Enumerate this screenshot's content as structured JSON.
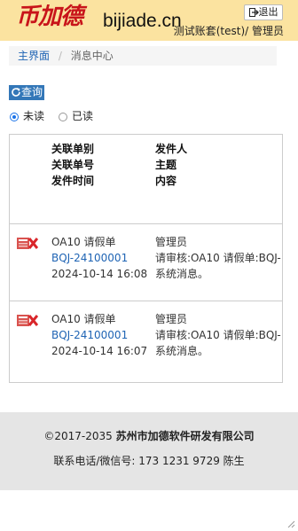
{
  "header": {
    "logo_cn": "币加德",
    "logo_en": "bijiade.cn",
    "logout_label": "退出",
    "user_info": "测试账套(test)/ 管理员"
  },
  "breadcrumb": {
    "home": "主界面",
    "separator": "/",
    "current": "消息中心"
  },
  "toolbar": {
    "query_label": "查询"
  },
  "filter": {
    "unread_label": "未读",
    "read_label": "已读",
    "selected": "未读"
  },
  "table": {
    "headers": {
      "col1": [
        "关联单别",
        "关联单号",
        "发件时间"
      ],
      "col2": [
        "发件人",
        "主题",
        "内容"
      ]
    },
    "rows": [
      {
        "doc_type": "OA10 请假单",
        "doc_no": "BQJ-24100001",
        "time": "2024-10-14 16:08",
        "sender": "管理员",
        "subject": "请审核:OA10 请假单:BQJ-",
        "content": "系统消息。"
      },
      {
        "doc_type": "OA10 请假单",
        "doc_no": "BQJ-24100001",
        "time": "2024-10-14 16:07",
        "sender": "管理员",
        "subject": "请审核:OA10 请假单:BQJ-",
        "content": "系统消息。"
      }
    ]
  },
  "footer": {
    "copyright": "©2017-2035",
    "company": "苏州市加德软件研发有限公司",
    "contact": "联系电话/微信号: 173 1231 9729 陈生"
  },
  "colors": {
    "header_bg": "#fbe3a0",
    "logo_red": "#c8141a",
    "link_blue": "#1f64b4",
    "button_blue": "#3377b8",
    "footer_bg": "#e5e5e5"
  },
  "icons": [
    "logout-icon",
    "refresh-icon",
    "delete-icon",
    "resize-grip-icon"
  ]
}
